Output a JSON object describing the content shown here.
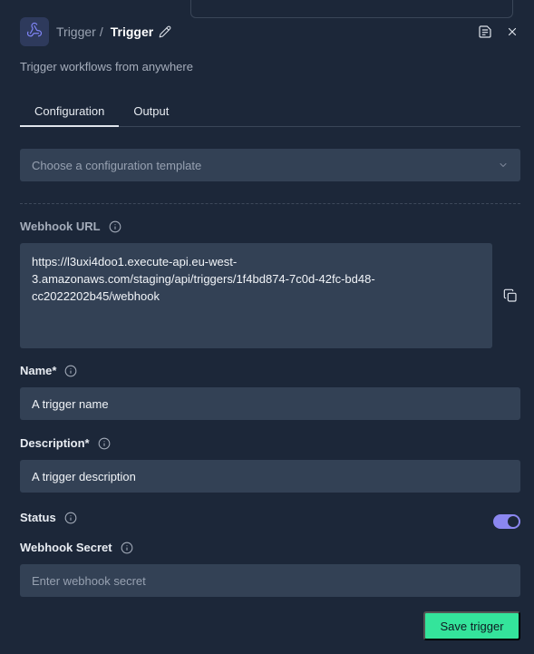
{
  "header": {
    "breadcrumb_parent": "Trigger",
    "breadcrumb_separator": "/",
    "title": "Trigger",
    "subtitle": "Trigger workflows from anywhere"
  },
  "tabs": [
    {
      "label": "Configuration",
      "active": true
    },
    {
      "label": "Output",
      "active": false
    }
  ],
  "template_select": {
    "placeholder": "Choose a configuration template"
  },
  "webhook_url": {
    "label": "Webhook URL",
    "value": "https://l3uxi4doo1.execute-api.eu-west-3.amazonaws.com/staging/api/triggers/1f4bd874-7c0d-42fc-bd48-cc2022202b45/webhook"
  },
  "name": {
    "label": "Name*",
    "value": "A trigger name"
  },
  "description": {
    "label": "Description*",
    "value": "A trigger description"
  },
  "status": {
    "label": "Status",
    "enabled": true
  },
  "webhook_secret": {
    "label": "Webhook Secret",
    "placeholder": "Enter webhook secret"
  },
  "actions": {
    "save_label": "Save trigger"
  },
  "colors": {
    "background": "#1c2739",
    "input_bg": "#334155",
    "accent_green": "#34e49b",
    "toggle_on": "#8b87f0"
  }
}
